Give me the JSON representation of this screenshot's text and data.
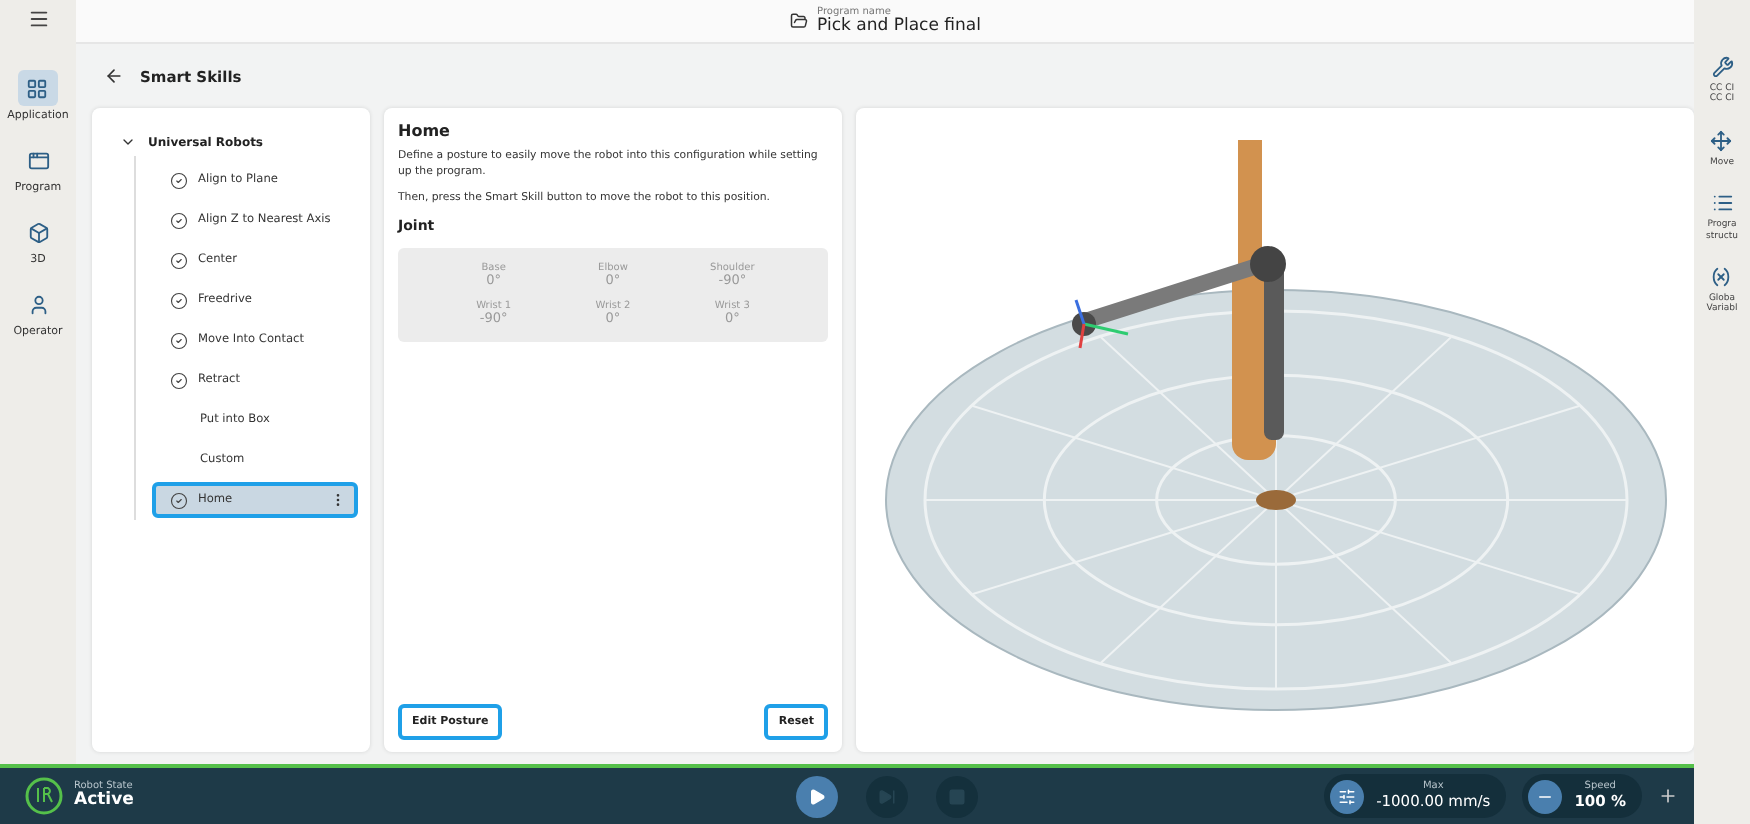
{
  "top_bar": {
    "program_label": "Program name",
    "program_name": "Pick and Place final"
  },
  "nav_rail": [
    {
      "label": "Application",
      "selected": true
    },
    {
      "label": "Program",
      "selected": false
    },
    {
      "label": "3D",
      "selected": false
    },
    {
      "label": "Operator",
      "selected": false
    }
  ],
  "header": {
    "title": "Smart Skills"
  },
  "skills": {
    "group": "Universal Robots",
    "expanded": true,
    "items": [
      {
        "label": "Align to Plane",
        "kind": "check",
        "selected": false
      },
      {
        "label": "Align Z to Nearest Axis",
        "kind": "check",
        "selected": false
      },
      {
        "label": "Center",
        "kind": "check",
        "selected": false
      },
      {
        "label": "Freedrive",
        "kind": "check",
        "selected": false
      },
      {
        "label": "Move Into Contact",
        "kind": "check",
        "selected": false
      },
      {
        "label": "Retract",
        "kind": "check",
        "selected": false
      },
      {
        "label": "Put into Box",
        "kind": "plain",
        "selected": false
      },
      {
        "label": "Custom",
        "kind": "plain",
        "selected": false
      },
      {
        "label": "Home",
        "kind": "check",
        "selected": true
      }
    ]
  },
  "detail": {
    "title": "Home",
    "paragraphs": [
      "Define a posture to easily move the robot into this configuration while setting up the program.",
      "Then, press the Smart Skill button to move the robot to this position."
    ],
    "section": "Joint",
    "joints": [
      {
        "name": "Base",
        "value": "0°"
      },
      {
        "name": "Elbow",
        "value": "0°"
      },
      {
        "name": "Shoulder",
        "value": "-90°"
      },
      {
        "name": "Wrist 1",
        "value": "-90°"
      },
      {
        "name": "Wrist 2",
        "value": "0°"
      },
      {
        "name": "Wrist 3",
        "value": "0°"
      }
    ],
    "buttons": [
      "Edit Posture",
      "Reset"
    ]
  },
  "right_rail": [
    {
      "lines": [
        "CC CI",
        "CC CI"
      ]
    },
    {
      "lines": [
        "Move"
      ]
    },
    {
      "lines": [
        "Progra",
        "structu"
      ]
    },
    {
      "lines": [
        "Globa",
        "Variabl"
      ]
    }
  ],
  "status_bar": {
    "state_label": "Robot State",
    "state": "Active",
    "max_label": "Max",
    "max_value": "-1000.00 mm/s",
    "speed_label": "Speed",
    "speed_value": "100 %"
  }
}
